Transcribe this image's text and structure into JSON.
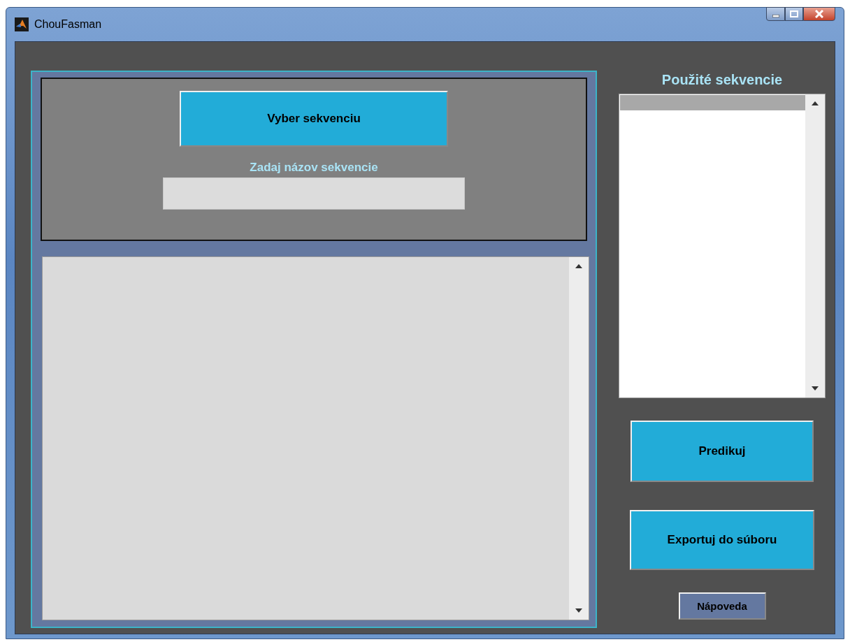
{
  "window": {
    "title": "ChouFasman"
  },
  "sequence_panel": {
    "select_button": "Vyber sekvenciu",
    "name_label": "Zadaj názov sekvencie"
  },
  "used_sequences": {
    "title": "Použité sekvencie",
    "items": [
      {
        "selected": true
      }
    ]
  },
  "buttons": [
    {
      "label": "Predikuj",
      "kind": "primary"
    },
    {
      "label": "Exportuj do súboru",
      "kind": "primary"
    },
    {
      "label": "Nápoveda",
      "kind": "help"
    }
  ]
}
